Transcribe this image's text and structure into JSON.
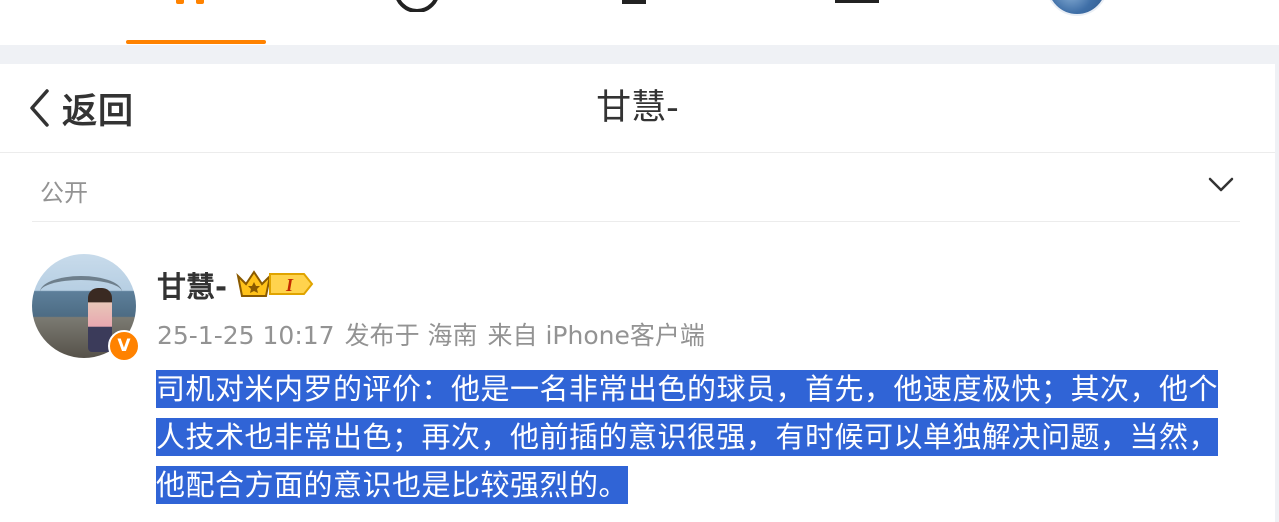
{
  "header": {
    "back_label": "返回",
    "title": "甘慧-"
  },
  "visibility": {
    "label": "公开"
  },
  "post": {
    "username": "甘慧-",
    "level_badge": "I",
    "verified_badge": "V",
    "meta": {
      "time": "25-1-25 10:17",
      "location": "发布于 海南",
      "source": "来自 iPhone客户端"
    },
    "text": "司机对米内罗的评价：他是一名非常出色的球员，首先，他速度极快；其次，他个人技术也非常出色；再次，他前插的意识很强，有时候可以单独解决问题，当然，他配合方面的意识也是比较强烈的。"
  },
  "colors": {
    "accent": "#ff8200",
    "selection": "#3064d6",
    "text": "#333333",
    "muted": "#939393"
  },
  "icons": {
    "nav": [
      "home-icon",
      "video-icon",
      "message-icon",
      "write-icon",
      "avatar"
    ],
    "back": "chevron-left-icon",
    "dropdown": "chevron-down-icon",
    "vip": "crown-icon"
  }
}
